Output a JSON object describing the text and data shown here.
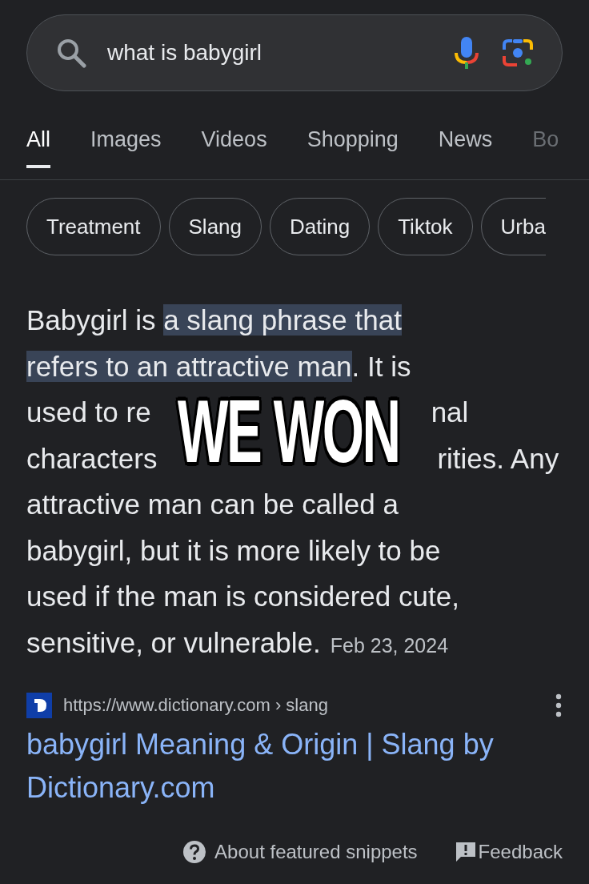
{
  "search": {
    "query": "what is babygirl"
  },
  "tabs": [
    {
      "label": "All",
      "selected": true
    },
    {
      "label": "Images",
      "selected": false
    },
    {
      "label": "Videos",
      "selected": false
    },
    {
      "label": "Shopping",
      "selected": false
    },
    {
      "label": "News",
      "selected": false
    },
    {
      "label": "Bo",
      "selected": false
    }
  ],
  "chips": [
    "Treatment",
    "Slang",
    "Dating",
    "Tiktok",
    "Urba"
  ],
  "snippet": {
    "lines": [
      [
        {
          "kind": "text",
          "text": "Babygirl is ",
          "highlighted": false
        },
        {
          "kind": "text",
          "text": "a slang phrase that",
          "highlighted": true
        }
      ],
      [
        {
          "kind": "text",
          "text": "refers to an attractive man",
          "highlighted": true
        },
        {
          "kind": "text",
          "text": ". It is",
          "highlighted": false
        }
      ],
      [
        {
          "kind": "text",
          "text": "used to re",
          "highlighted": false
        },
        {
          "kind": "hidden"
        },
        {
          "kind": "text",
          "text": "nal",
          "highlighted": false
        }
      ],
      [
        {
          "kind": "text",
          "text": "characters",
          "highlighted": false
        },
        {
          "kind": "hidden"
        },
        {
          "kind": "text",
          "text": "rities. Any",
          "highlighted": false
        }
      ],
      [
        {
          "kind": "text",
          "text": "attractive man can be called a",
          "highlighted": false
        }
      ],
      [
        {
          "kind": "text",
          "text": "babygirl, but it is more likely to be",
          "highlighted": false
        }
      ],
      [
        {
          "kind": "text",
          "text": "used if the man is considered cute,",
          "highlighted": false
        }
      ],
      [
        {
          "kind": "text",
          "text": "sensitive, or vulnerable.",
          "highlighted": false
        }
      ]
    ],
    "date": "Feb 23, 2024"
  },
  "overlay_caption": "WE WON",
  "source": {
    "url": "https://www.dictionary.com › slang",
    "title": "babygirl Meaning & Origin | Slang by Dictionary.com"
  },
  "footer": {
    "about": "About featured snippets",
    "feedback": "Feedback"
  }
}
